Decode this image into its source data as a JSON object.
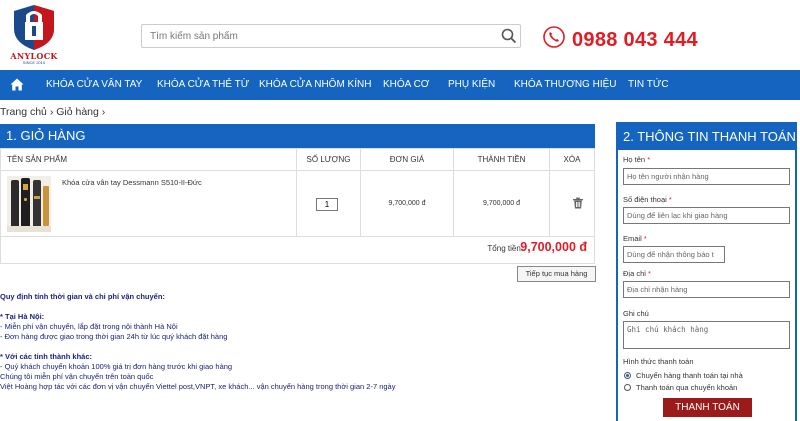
{
  "header": {
    "logo_text": "ANYLOCK",
    "logo_sub": "SINCE 2010",
    "search_placeholder": "Tìm kiếm sản phẩm",
    "phone": "0988 043 444"
  },
  "nav": {
    "items": [
      {
        "label": "KHÓA CỬA VÂN TAY"
      },
      {
        "label": "KHÓA CỬA THẺ TỪ"
      },
      {
        "label": "KHÓA CỬA NHÔM KÍNH"
      },
      {
        "label": "KHÓA CƠ"
      },
      {
        "label": "PHỤ KIỆN"
      },
      {
        "label": "KHÓA THƯƠNG HIỆU"
      },
      {
        "label": "TIN TỨC"
      }
    ]
  },
  "breadcrumb": {
    "home": "Trang chủ",
    "sep1": "›",
    "current": "Giỏ hàng",
    "sep2": "›"
  },
  "cart": {
    "title": "1. GIỎ HÀNG",
    "columns": {
      "name": "TÊN SẢN PHẨM",
      "qty": "SỐ LƯỢNG",
      "unit_price": "ĐƠN GIÁ",
      "subtotal": "THÀNH TIỀN",
      "remove": "XÓA"
    },
    "items": [
      {
        "name": "Khóa cửa vân tay Dessmann S510-II-Đức",
        "qty": "1",
        "unit_price": "9,700,000 đ",
        "subtotal": "9,700,000 đ"
      }
    ],
    "total_label": "Tổng tiền:",
    "total_value": "9,700,000 đ",
    "continue_label": "Tiếp tục mua hàng"
  },
  "shipping": {
    "title": "Quy định tính thời gian và chi phí vận chuyển:",
    "hanoi_title": "* Tại Hà Nội:",
    "hanoi_lines": [
      "- Miễn phí vận chuyển, lắp đặt trong nội thành Hà Nội",
      "- Đơn hàng được giao trong thời gian 24h từ lúc quý khách đặt hàng"
    ],
    "other_title": "* Với các tỉnh thành khác:",
    "other_lines": [
      "- Quý khách chuyển khoản 100% giá trị đơn hàng trước khi giao hàng",
      "Chúng tôi miễn phí vận chuyển trên toàn quốc",
      "Việt Hoàng hợp tác với các đơn vị vận chuyển Viettel post,VNPT, xe khách... vận chuyển hàng trong thời gian 2-7 ngày"
    ]
  },
  "checkout": {
    "title": "2. THÔNG TIN THANH TOÁN",
    "name_label": "Họ tên",
    "name_placeholder": "Họ tên người nhận hàng",
    "phone_label": "Số điện thoại",
    "phone_placeholder": "Dùng để liên lạc khi giao hàng",
    "email_label": "Email",
    "email_placeholder": "Dùng để nhận thông báo t",
    "address_label": "Địa chỉ",
    "address_placeholder": "Địa chỉ nhận hàng",
    "note_label": "Ghi chú",
    "note_placeholder": "Ghi chú khách hàng",
    "method_label": "Hình thức thanh toán",
    "method_options": [
      {
        "label": "Chuyển hàng thanh toán tại nhà",
        "checked": true
      },
      {
        "label": "Thanh toán qua chuyển khoản",
        "checked": false
      }
    ],
    "required_mark": "*",
    "submit_label": "THANH TOÁN"
  },
  "colors": {
    "primary": "#1565c0",
    "accent_red": "#e31b23",
    "submit_bg": "#9b1b1b"
  }
}
